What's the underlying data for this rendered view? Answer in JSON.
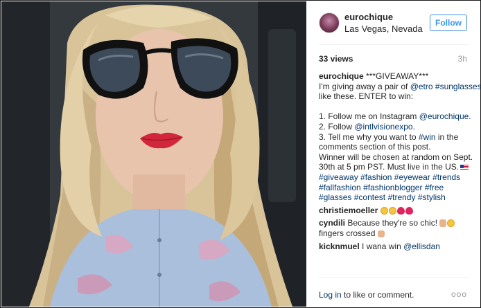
{
  "post": {
    "username": "eurochique",
    "location": "Las Vegas, Nevada",
    "follow_label": "Follow",
    "views": "33 views",
    "time": "3h"
  },
  "caption": {
    "user": "eurochique",
    "l1": "***GIVEAWAY***",
    "l2a": "I'm giving away a pair of ",
    "l2b": "@etro",
    "l2c": "#sunglasses",
    "l3": "like these. ENTER to win:",
    "l4a": "1. Follow me on Instagram ",
    "l4b": "@eurochique",
    "l4c": ".",
    "l5a": "2. Follow ",
    "l5b": "@intlvisionexpo",
    "l5c": ".",
    "l6a": "3. Tell me why you want to ",
    "l6b": "#win",
    "l6c": " in the",
    "l7": "comments section of this post.",
    "l8": "Winner will be chosen at random on Sept.",
    "l9": "30th at 5 pm PST. Must live in the US.",
    "tags1": [
      "#giveaway",
      "#fashion",
      "#eyewear",
      "#trends"
    ],
    "tags2": [
      "#fallfashion",
      "#fashionblogger",
      "#free"
    ],
    "tags3": [
      "#glasses",
      "#contest",
      "#trendy",
      "#stylish"
    ]
  },
  "comments": [
    {
      "user": "christiemoeller",
      "text": ""
    },
    {
      "user": "cyndili",
      "text": "Because they're so chic!",
      "text2": "fingers crossed"
    },
    {
      "user": "kicknmuel",
      "text": "I wana win ",
      "mention": "@ellisdan"
    }
  ],
  "footer": {
    "login_link": "Log in",
    "login_rest": " to like or comment.",
    "more_label": "ooo"
  },
  "colors": {
    "link": "#003569",
    "follow_blue": "#3897f0",
    "time_gray": "#999999"
  }
}
